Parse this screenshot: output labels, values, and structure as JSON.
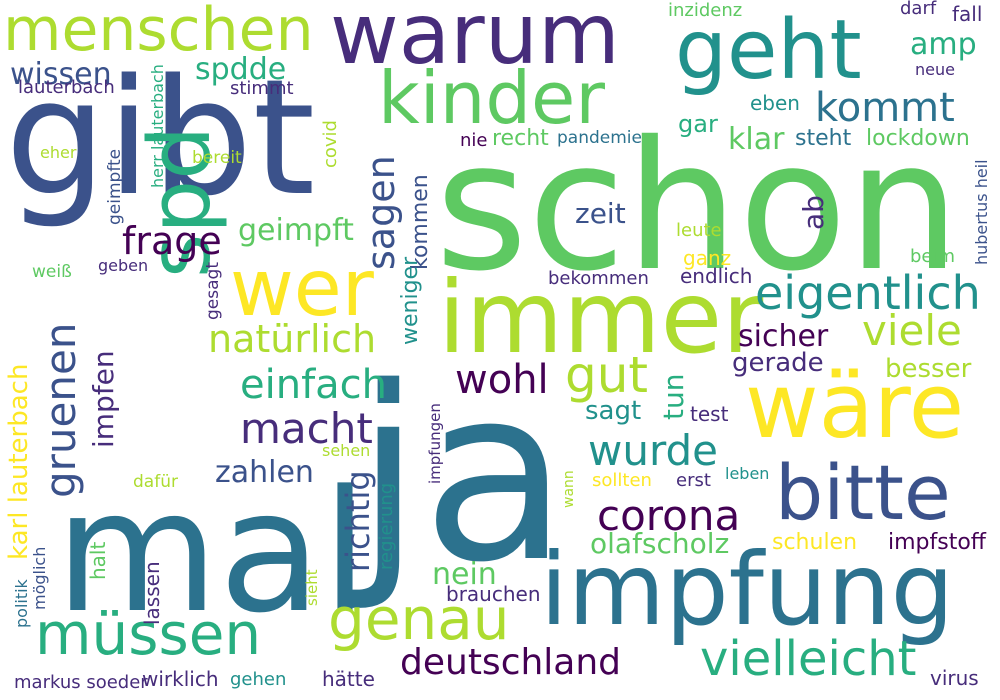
{
  "palette": {
    "dark_purple": "#440154",
    "purple": "#472d7b",
    "indigo": "#3b528b",
    "blue": "#2c728e",
    "teal": "#21918c",
    "green_teal": "#28ae80",
    "green": "#5ec962",
    "lime": "#addc30",
    "yellow": "#fde725"
  },
  "words": [
    {
      "text": "schon",
      "color": "#5ec962",
      "icon": null
    },
    {
      "text": "ja",
      "color": "#2c728e"
    },
    {
      "text": "gibt",
      "color": "#3b528b"
    },
    {
      "text": "mal",
      "color": "#2c728e"
    },
    {
      "text": "warum",
      "color": "#472d7b"
    },
    {
      "text": "immer",
      "color": "#addc30"
    },
    {
      "text": "impfung",
      "color": "#2c728e"
    },
    {
      "text": "geht",
      "color": "#21918c"
    },
    {
      "text": "kinder",
      "color": "#5ec962"
    },
    {
      "text": "wäre",
      "color": "#fde725"
    },
    {
      "text": "bitte",
      "color": "#3b528b"
    },
    {
      "text": "menschen",
      "color": "#addc30"
    },
    {
      "text": "spd",
      "color": "#28ae80"
    },
    {
      "text": "wer",
      "color": "#fde725"
    },
    {
      "text": "müssen",
      "color": "#28ae80"
    },
    {
      "text": "genau",
      "color": "#addc30"
    },
    {
      "text": "eigentlich",
      "color": "#21918c"
    },
    {
      "text": "vielleicht",
      "color": "#28ae80"
    },
    {
      "text": "deutschland",
      "color": "#440154"
    },
    {
      "text": "kommt",
      "color": "#2c728e"
    },
    {
      "text": "corona",
      "color": "#440154"
    },
    {
      "text": "wurde",
      "color": "#21918c"
    },
    {
      "text": "natürlich",
      "color": "#addc30"
    },
    {
      "text": "gruenen",
      "color": "#3b528b"
    },
    {
      "text": "macht",
      "color": "#472d7b"
    },
    {
      "text": "einfach",
      "color": "#28ae80"
    },
    {
      "text": "frage",
      "color": "#440154"
    },
    {
      "text": "gut",
      "color": "#addc30"
    },
    {
      "text": "viele",
      "color": "#addc30"
    },
    {
      "text": "wohl",
      "color": "#440154"
    },
    {
      "text": "sagen",
      "color": "#3b528b"
    },
    {
      "text": "geimpft",
      "color": "#5ec962"
    },
    {
      "text": "wissen",
      "color": "#3b528b"
    },
    {
      "text": "spdde",
      "color": "#28ae80"
    },
    {
      "text": "zahlen",
      "color": "#3b528b"
    },
    {
      "text": "sicher",
      "color": "#440154"
    },
    {
      "text": "richtig",
      "color": "#3b528b"
    },
    {
      "text": "nein",
      "color": "#5ec962"
    },
    {
      "text": "klar",
      "color": "#5ec962"
    },
    {
      "text": "amp",
      "color": "#28ae80"
    },
    {
      "text": "gerade",
      "color": "#472d7b"
    },
    {
      "text": "besser",
      "color": "#addc30"
    },
    {
      "text": "olafscholz",
      "color": "#5ec962"
    },
    {
      "text": "karl lauterbach",
      "color": "#fde725"
    },
    {
      "text": "tun",
      "color": "#28ae80"
    },
    {
      "text": "zeit",
      "color": "#3b528b"
    },
    {
      "text": "ab",
      "color": "#472d7b"
    },
    {
      "text": "sagt",
      "color": "#21918c"
    },
    {
      "text": "impfen",
      "color": "#472d7b"
    },
    {
      "text": "gar",
      "color": "#28ae80"
    },
    {
      "text": "recht",
      "color": "#5ec962"
    },
    {
      "text": "steht",
      "color": "#2c728e"
    },
    {
      "text": "lockdown",
      "color": "#5ec962"
    },
    {
      "text": "eben",
      "color": "#21918c"
    },
    {
      "text": "kommen",
      "color": "#3b528b"
    },
    {
      "text": "weniger",
      "color": "#21918c"
    },
    {
      "text": "impfstoff",
      "color": "#440154"
    },
    {
      "text": "schulen",
      "color": "#fde725"
    },
    {
      "text": "test",
      "color": "#472d7b"
    },
    {
      "text": "sollten",
      "color": "#fde725"
    },
    {
      "text": "erst",
      "color": "#472d7b"
    },
    {
      "text": "ganz",
      "color": "#fde725"
    },
    {
      "text": "endlich",
      "color": "#472d7b"
    },
    {
      "text": "leute",
      "color": "#addc30"
    },
    {
      "text": "beim",
      "color": "#5ec962"
    },
    {
      "text": "bekommen",
      "color": "#472d7b"
    },
    {
      "text": "regierung",
      "color": "#21918c"
    },
    {
      "text": "lassen",
      "color": "#472d7b"
    },
    {
      "text": "halt",
      "color": "#5ec962"
    },
    {
      "text": "brauchen",
      "color": "#472d7b"
    },
    {
      "text": "hätte",
      "color": "#472d7b"
    },
    {
      "text": "wirklich",
      "color": "#472d7b"
    },
    {
      "text": "gehen",
      "color": "#21918c"
    },
    {
      "text": "virus",
      "color": "#472d7b"
    },
    {
      "text": "markus soeder",
      "color": "#472d7b"
    },
    {
      "text": "lauterbach",
      "color": "#472d7b"
    },
    {
      "text": "stimmt",
      "color": "#472d7b"
    },
    {
      "text": "inzidenz",
      "color": "#5ec962"
    },
    {
      "text": "darf",
      "color": "#472d7b"
    },
    {
      "text": "fall",
      "color": "#472d7b"
    },
    {
      "text": "neue",
      "color": "#472d7b"
    },
    {
      "text": "pandemie",
      "color": "#2c728e"
    },
    {
      "text": "nie",
      "color": "#440154"
    },
    {
      "text": "covid",
      "color": "#addc30"
    },
    {
      "text": "bereit",
      "color": "#addc30"
    },
    {
      "text": "eher",
      "color": "#addc30"
    },
    {
      "text": "geimpfte",
      "color": "#3b528b"
    },
    {
      "text": "herr lauterbach",
      "color": "#28ae80"
    },
    {
      "text": "weiß",
      "color": "#5ec962"
    },
    {
      "text": "geben",
      "color": "#472d7b"
    },
    {
      "text": "gesagt",
      "color": "#472d7b"
    },
    {
      "text": "hubertus heil",
      "color": "#3b528b"
    },
    {
      "text": "sehen",
      "color": "#addc30"
    },
    {
      "text": "impfungen",
      "color": "#472d7b"
    },
    {
      "text": "dafür",
      "color": "#addc30"
    },
    {
      "text": "wann",
      "color": "#addc30"
    },
    {
      "text": "leben",
      "color": "#21918c"
    },
    {
      "text": "sieht",
      "color": "#addc30"
    },
    {
      "text": "politik",
      "color": "#2c728e"
    },
    {
      "text": "möglich",
      "color": "#3b528b"
    }
  ]
}
